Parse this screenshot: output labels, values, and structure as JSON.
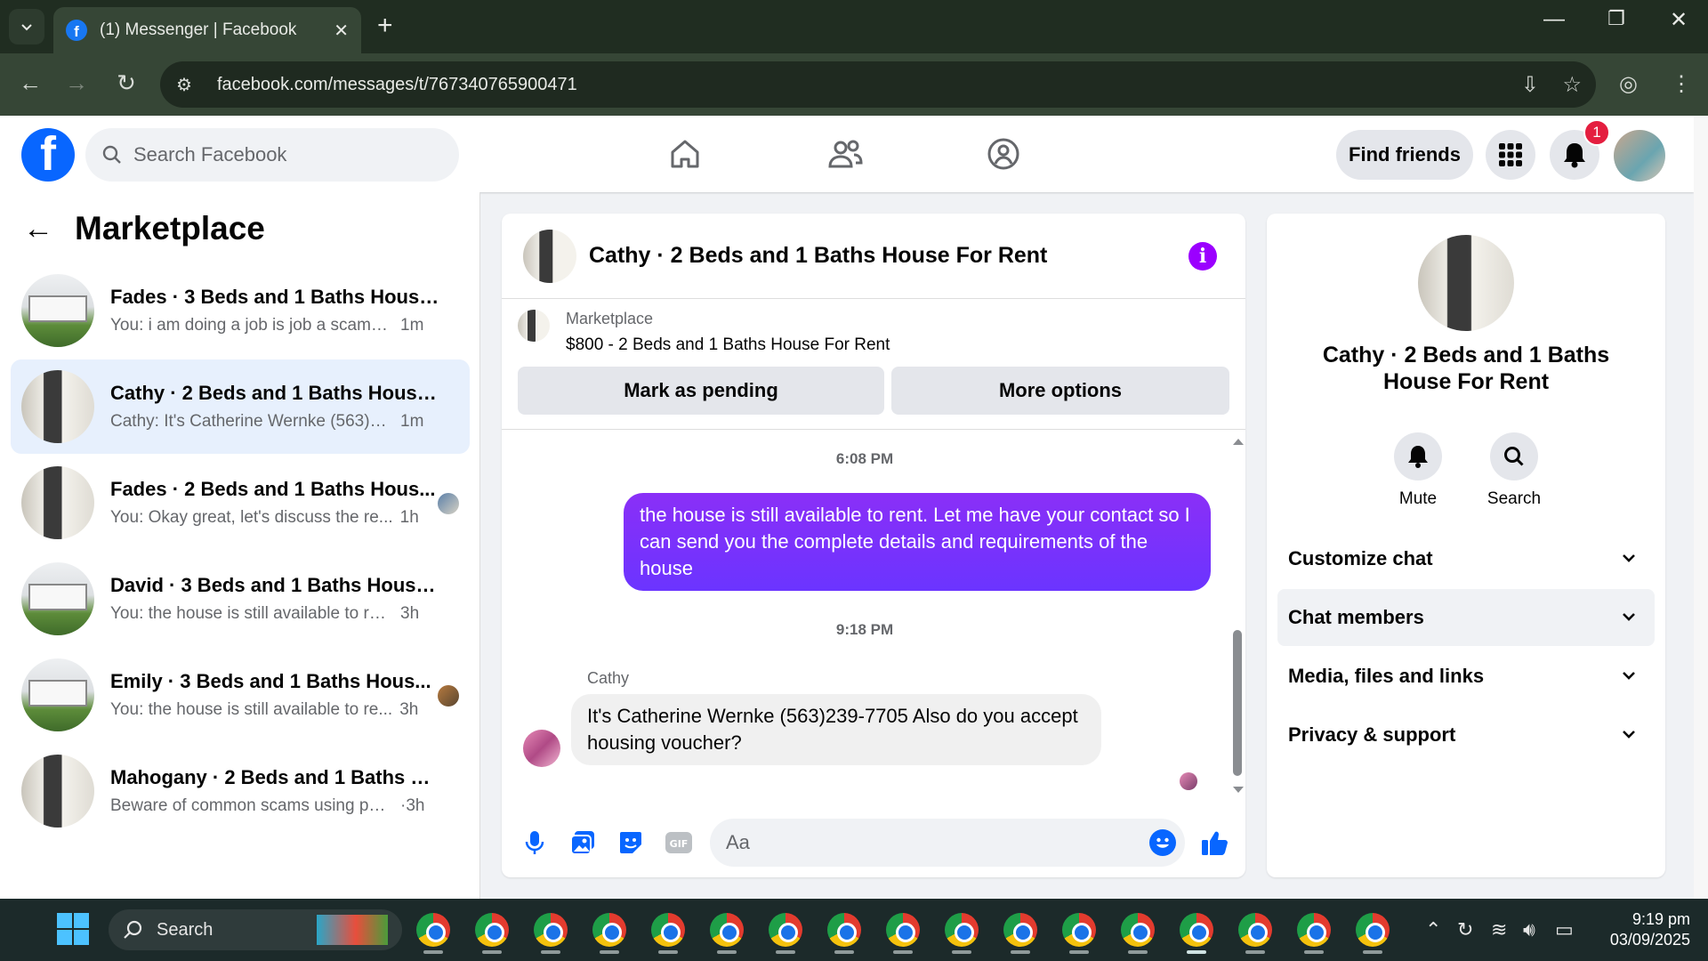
{
  "browser": {
    "tab_title": "(1) Messenger | Facebook",
    "url": "facebook.com/messages/t/767340765900471"
  },
  "fbnav": {
    "search_placeholder": "Search Facebook",
    "find_friends": "Find friends",
    "notification_count": "1"
  },
  "left": {
    "title": "Marketplace",
    "conversations": [
      {
        "name": "Fades · 3 Beds and 1 Baths House F...",
        "preview": "You: i am doing a job is job a scam? ...",
        "time": "1m"
      },
      {
        "name": "Cathy · 2 Beds and 1 Baths House ...",
        "preview": "Cathy: It's Catherine Wernke (563)239....",
        "time": "1m"
      },
      {
        "name": "Fades · 2 Beds and 1 Baths Hous...",
        "preview": "You: Okay great, let's discuss the re...",
        "time": "1h"
      },
      {
        "name": "David · 3 Beds and 1 Baths House ...",
        "preview": "You: the house is still available to rent....",
        "time": "3h"
      },
      {
        "name": "Emily · 3 Beds and 1 Baths Hous...",
        "preview": "You: the house is still available to re...",
        "time": "3h"
      },
      {
        "name": "Mahogany · 2 Beds and 1 Baths Ho...",
        "preview": "Beware of common scams using pay...",
        "time": "·3h"
      }
    ]
  },
  "chat": {
    "header_name": "Cathy · 2 Beds and 1 Baths House For Rent",
    "marketplace_label": "Marketplace",
    "listing": "$800 - 2 Beds and 1 Baths House For Rent",
    "mark_pending": "Mark as pending",
    "more_options": "More options",
    "time1": "6:08 PM",
    "outgoing": "the house is still available to rent. Let me have your contact so I can send you the complete details and requirements of the house",
    "time2": "9:18 PM",
    "sender": "Cathy",
    "incoming": "It's Catherine Wernke (563)239-7705 Also do you accept housing voucher?",
    "composer_placeholder": "Aa"
  },
  "right": {
    "name": "Cathy · 2 Beds and 1 Baths House For Rent",
    "mute": "Mute",
    "search": "Search",
    "sections": [
      "Customize chat",
      "Chat members",
      "Media, files and links",
      "Privacy & support"
    ]
  },
  "taskbar": {
    "search": "Search",
    "time": "9:19 pm",
    "date": "03/09/2025"
  },
  "colors": {
    "fb_blue": "#0866ff",
    "messenger_purple": "#7b2ff7",
    "active_conversation": "#e7f0fd"
  }
}
